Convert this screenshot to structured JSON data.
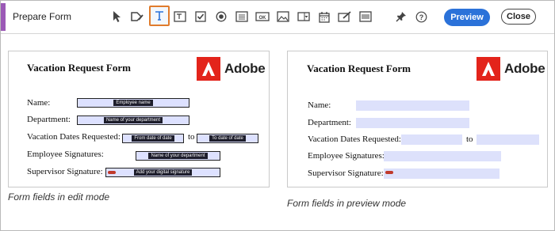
{
  "toolbar": {
    "title": "Prepare Form",
    "accent_color": "#9b59b6",
    "tools": [
      {
        "name": "select-tool-icon"
      },
      {
        "name": "add-text-tool-icon"
      },
      {
        "name": "text-field-icon",
        "selected": true
      },
      {
        "name": "multiline-text-field-icon"
      },
      {
        "name": "checkbox-icon"
      },
      {
        "name": "radio-button-icon"
      },
      {
        "name": "list-box-icon"
      },
      {
        "name": "button-ok-icon"
      },
      {
        "name": "image-field-icon"
      },
      {
        "name": "dropdown-icon"
      },
      {
        "name": "date-picker-icon"
      },
      {
        "name": "signature-field-icon"
      },
      {
        "name": "barcode-icon"
      },
      {
        "name": "pin-icon"
      },
      {
        "name": "help-icon"
      }
    ],
    "preview_label": "Preview",
    "close_label": "Close",
    "preview_color": "#2b72d9",
    "selected_outline_color": "#e07b2c"
  },
  "edit_panel": {
    "form_title": "Vacation Request Form",
    "brand": "Adobe",
    "labels": {
      "name": "Name:",
      "department": "Department:",
      "vacation_dates": "Vacation Dates Requested:",
      "to": "to",
      "employee_sig": "Employee Signatures:",
      "supervisor_sig": "Supervisor Signature:"
    },
    "field_texts": {
      "name": "Employee name",
      "department": "Name of your department",
      "from_date": "From date of date",
      "to_date": "To date of date",
      "employee_sig": "Name of your department",
      "supervisor_sig": "Add your digital signature"
    },
    "caption": "Form fields in edit mode"
  },
  "preview_panel": {
    "form_title": "Vacation Request Form",
    "brand": "Adobe",
    "labels": {
      "name": "Name:",
      "department": "Department:",
      "vacation_dates": "Vacation Dates Requested:",
      "to": "to",
      "employee_sig": "Employee Signatures:",
      "supervisor_sig": "Supervisor Signature:"
    },
    "caption": "Form fields in preview mode"
  },
  "colors": {
    "field_fill": "#dde1ff",
    "adobe_red": "#e3241b"
  }
}
